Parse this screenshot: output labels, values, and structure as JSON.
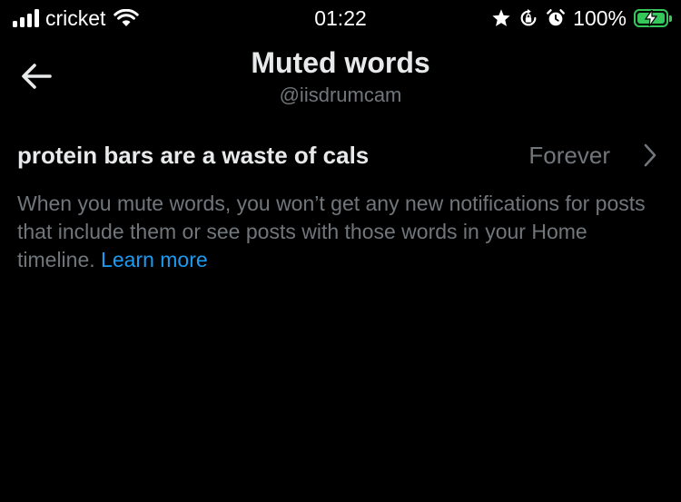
{
  "status_bar": {
    "carrier": "cricket",
    "time": "01:22",
    "battery_percent": "100%",
    "battery_level": 1.0,
    "signal_bars": 4,
    "icons": [
      "signal-icon",
      "wifi-icon",
      "star-icon",
      "rotation-lock-icon",
      "alarm-icon",
      "battery-charging-icon"
    ]
  },
  "header": {
    "title": "Muted words",
    "subtitle": "@iisdrumcam",
    "back_icon": "back-arrow-icon"
  },
  "muted_words": [
    {
      "word": "protein bars are a waste of cals",
      "duration": "Forever",
      "icon": "chevron-right-icon"
    }
  ],
  "info": {
    "text": "When you mute words, you won’t get any new notifications for posts that include them or see posts with those words in your Home timeline.",
    "link_text": "Learn more"
  },
  "colors": {
    "background": "#000000",
    "primary_text": "#e7e9ea",
    "secondary_text": "#71767b",
    "link": "#1d9bf0",
    "battery": "#34c759"
  }
}
